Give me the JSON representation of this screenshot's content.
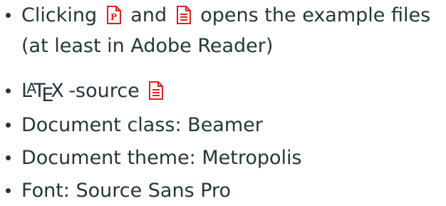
{
  "items": [
    {
      "before": "Clicking",
      "mid": "and",
      "after": "opens the example files",
      "line2": "(at least in Adobe Reader)",
      "icons": [
        "pdf-presentation-icon",
        "pdf-file-icon"
      ]
    },
    {
      "latex_l": "L",
      "latex_a": "A",
      "latex_t": "T",
      "latex_e": "E",
      "latex_x": "X",
      "suffix": "-source",
      "icons": [
        "source-file-icon"
      ]
    },
    {
      "text": "Document class: Beamer"
    },
    {
      "text": "Document theme: Metropolis"
    },
    {
      "text": "Font: Source Sans Pro"
    }
  ],
  "colors": {
    "text": "#23373b",
    "icon_red": "#e0201b",
    "background": "#ffffff"
  }
}
